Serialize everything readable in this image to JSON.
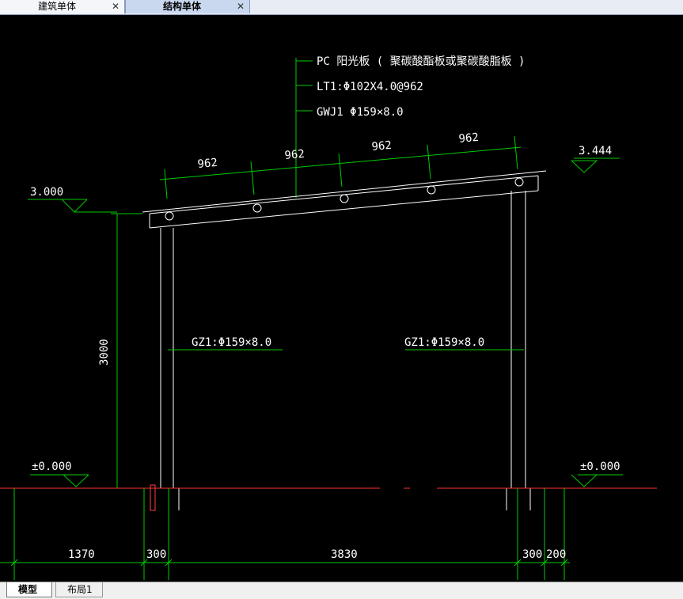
{
  "tabs": [
    {
      "label": "建筑单体",
      "close": "✕"
    },
    {
      "label": "结构单体",
      "close": "✕"
    }
  ],
  "annotations": {
    "roof_panel": "PC  阳光板  ( 聚碳酸酯板或聚碳酸脂板          )",
    "purlin": "LT1:Φ102X4.0@962",
    "roof_beam": "GWJ1 Φ159×8.0",
    "column_left": "GZ1:Φ159×8.0",
    "column_right": "GZ1:Φ159×8.0"
  },
  "elevations": {
    "left_top": "3.000",
    "right_top": "3.444",
    "left_ground": "±0.000",
    "right_ground": "±0.000"
  },
  "dimensions": {
    "slope_spacings": [
      "962",
      "962",
      "962",
      "962"
    ],
    "height": "3000",
    "bottom": [
      "1370",
      "300",
      "3830",
      "300",
      "200"
    ]
  },
  "layout_tabs": {
    "model": "模型",
    "layout": "布局1"
  },
  "colors": {
    "background": "#000000",
    "structure": "#ffffff",
    "dimension": "#00cc00",
    "text": "#ffffff",
    "ground_line": "#ff3030"
  }
}
